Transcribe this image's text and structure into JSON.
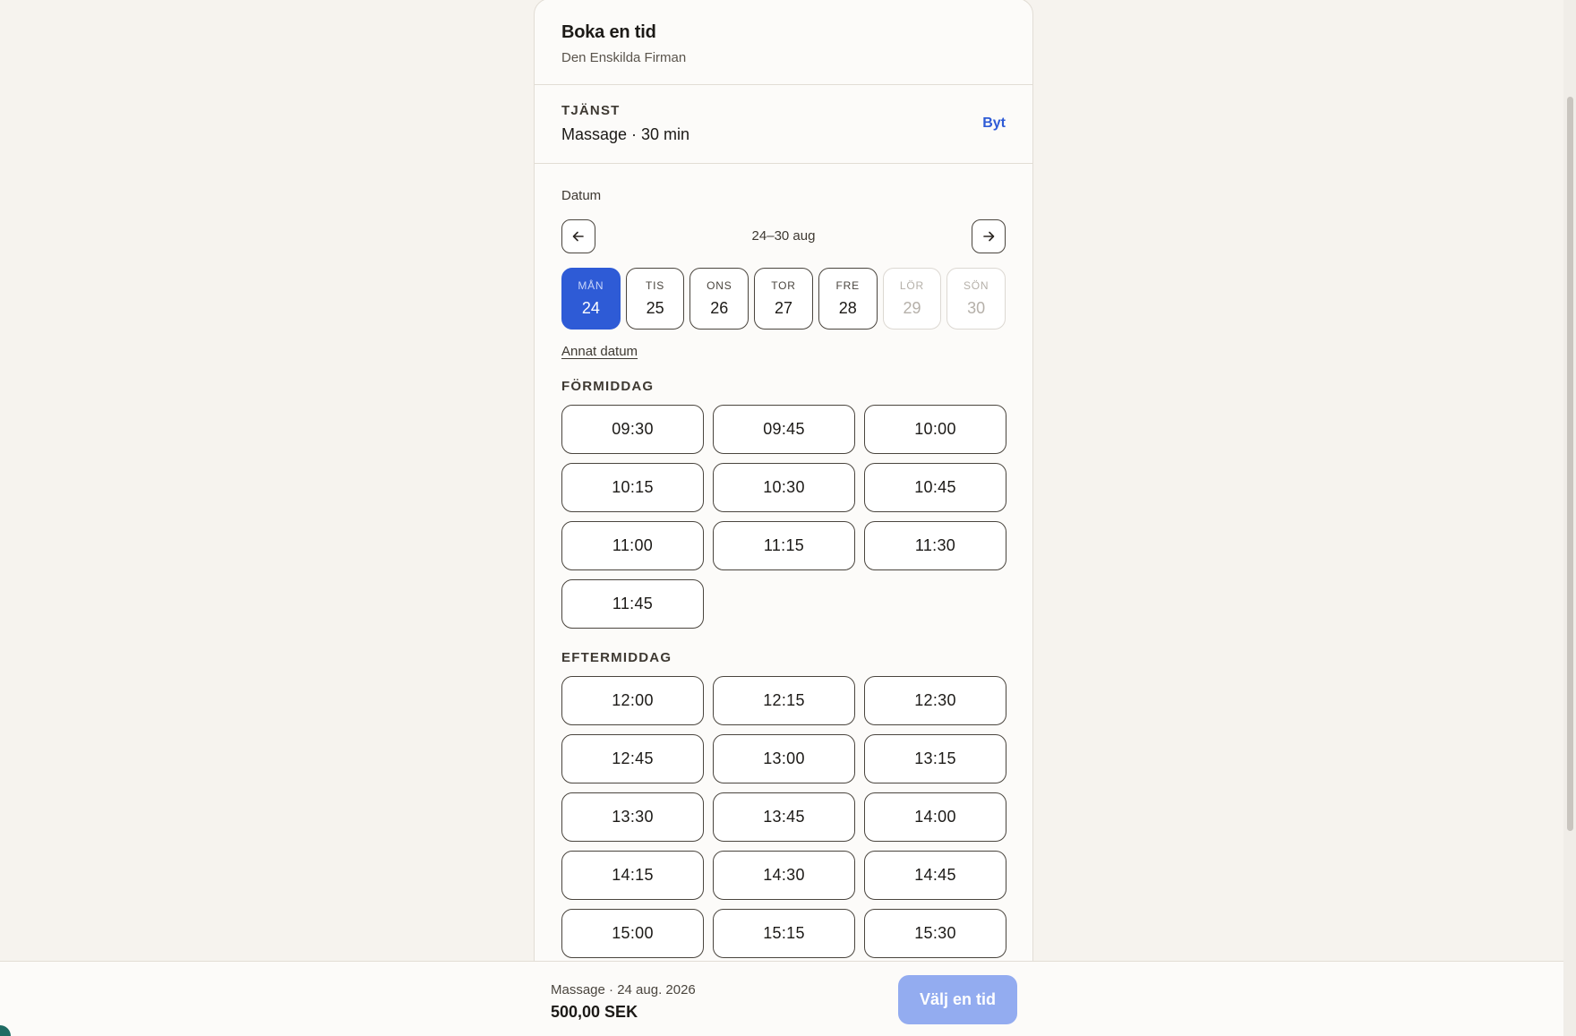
{
  "header": {
    "title": "Boka en tid",
    "subtitle": "Den Enskilda Firman"
  },
  "service": {
    "label": "TJÄNST",
    "value": "Massage · 30 min",
    "swap_label": "Byt"
  },
  "date": {
    "label": "Datum",
    "range": "24–30 aug",
    "days": [
      {
        "name": "MÅN",
        "num": "24",
        "state": "selected"
      },
      {
        "name": "TIS",
        "num": "25",
        "state": "available"
      },
      {
        "name": "ONS",
        "num": "26",
        "state": "available"
      },
      {
        "name": "TOR",
        "num": "27",
        "state": "available"
      },
      {
        "name": "FRE",
        "num": "28",
        "state": "available"
      },
      {
        "name": "LÖR",
        "num": "29",
        "state": "disabled"
      },
      {
        "name": "SÖN",
        "num": "30",
        "state": "disabled"
      }
    ],
    "other_date_label": "Annat datum"
  },
  "morning": {
    "label": "FÖRMIDDAG",
    "slots": [
      "09:30",
      "09:45",
      "10:00",
      "10:15",
      "10:30",
      "10:45",
      "11:00",
      "11:15",
      "11:30",
      "11:45"
    ]
  },
  "afternoon": {
    "label": "EFTERMIDDAG",
    "slots": [
      "12:00",
      "12:15",
      "12:30",
      "12:45",
      "13:00",
      "13:15",
      "13:30",
      "13:45",
      "14:00",
      "14:15",
      "14:30",
      "14:45",
      "15:00",
      "15:15",
      "15:30"
    ]
  },
  "footer": {
    "summary": "Massage · 24 aug. 2026",
    "price": "500,00 SEK",
    "cta_label": "Välj en tid"
  },
  "colors": {
    "accent": "#2e5bd6",
    "cta_disabled": "#93acf0",
    "background": "#f6f3ee"
  }
}
